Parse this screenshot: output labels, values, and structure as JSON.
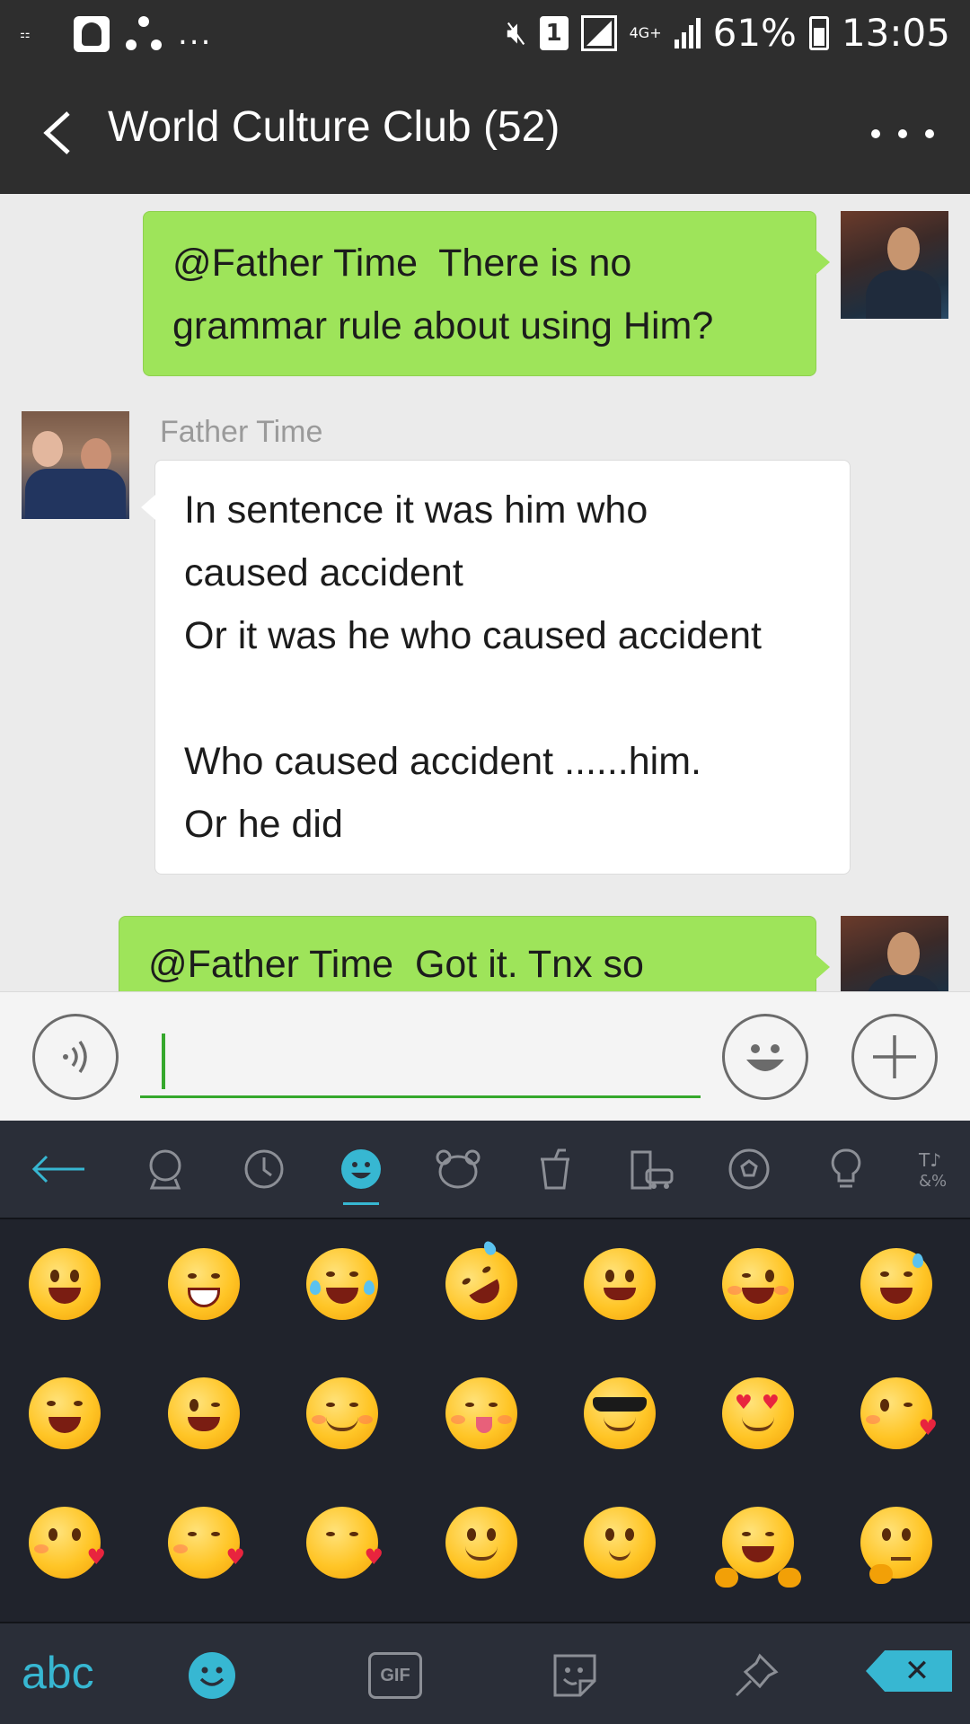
{
  "status_bar": {
    "battery": "61%",
    "time": "13:05",
    "sim_slot": "1",
    "network": "4G+",
    "more_indicator": "..."
  },
  "header": {
    "title": "World Culture Club (52)",
    "back_icon": "chevron-left-icon",
    "more_icon": "more-dots-icon"
  },
  "messages": [
    {
      "direction": "outgoing",
      "text": "@Father Time  There is no\ngrammar rule about using Him?"
    },
    {
      "direction": "incoming",
      "sender": "Father Time",
      "text": "In sentence it was him who\ncaused accident\nOr it was he who caused accident\n\nWho caused accident ......him.\nOr he did"
    },
    {
      "direction": "outgoing",
      "text": "@Father Time  Got it. Tnx so"
    }
  ],
  "input_bar": {
    "value": "",
    "voice_icon": "voice-icon",
    "emoji_icon": "emoji-icon",
    "plus_icon": "plus-icon"
  },
  "keyboard": {
    "accent_color": "#37b7d2",
    "tabs": [
      "back-arrow-icon",
      "recent-icon",
      "clock-icon",
      "smiley-icon",
      "animal-icon",
      "cup-icon",
      "building-icon",
      "ball-icon",
      "bulb-icon",
      "symbols-icon"
    ],
    "active_tab": "smiley-icon",
    "emojis": [
      "grinning",
      "beaming",
      "tears-of-joy",
      "rofl",
      "grinning-big-eyes",
      "winking-tongue",
      "sweat-smile",
      "squinting-laugh",
      "winking-smile",
      "smiling-eyes",
      "savoring",
      "sunglasses",
      "heart-eyes",
      "kissing-heart",
      "kissing-heart-2",
      "kissing-closed-eyes",
      "kissing-heart-3",
      "slight-smile",
      "slight-smile-2",
      "hugging",
      "thinking"
    ],
    "bottom": {
      "abc_label": "abc",
      "gif_label": "GIF",
      "delete_label": "✕"
    }
  }
}
